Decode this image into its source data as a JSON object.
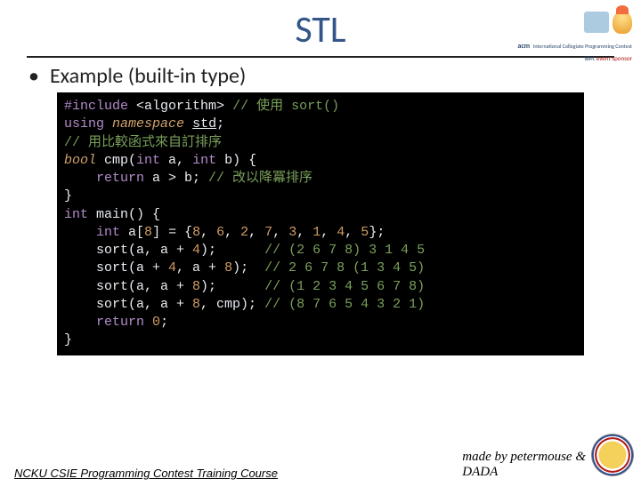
{
  "title": "STL",
  "header_logos": {
    "acm_text": "acm",
    "acm_sub": "International Collegiate Programming Contest",
    "ibm_text": "IBM.",
    "sponsor": "event sponsor"
  },
  "bullet": "Example (built-in type)",
  "code": {
    "l1a": "#include",
    "l1b": "<algorithm>",
    "l1c": "// 使用 sort()",
    "l2a": "using",
    "l2b": "namespace",
    "l2c": "std",
    "l2d": ";",
    "l3": "// 用比較函式來自訂排序",
    "l4a": "bool",
    "l4b": " cmp(",
    "l4c": "int",
    "l4d": " a, ",
    "l4e": "int",
    "l4f": " b) {",
    "l5a": "return",
    "l5b": " a > b; ",
    "l5c": "// 改以降冪排序",
    "l6": "}",
    "l7a": "int",
    "l7b": " main() {",
    "l8a": "int",
    "l8b": " a[",
    "l8c": "8",
    "l8d": "] = {",
    "l8e": "8",
    "l8f": ", ",
    "l8g": "6",
    "l8h": ", ",
    "l8i": "2",
    "l8j": ", ",
    "l8k": "7",
    "l8l": ", ",
    "l8m": "3",
    "l8n": ", ",
    "l8o": "1",
    "l8p": ", ",
    "l8q": "4",
    "l8r": ", ",
    "l8s": "5",
    "l8t": "};",
    "l9a": "    sort(a, a + ",
    "l9b": "4",
    "l9c": ");      ",
    "l9d": "// (2 6 7 8) 3 1 4 5",
    "l10a": "    sort(a + ",
    "l10b": "4",
    "l10c": ", a + ",
    "l10d": "8",
    "l10e": ");  ",
    "l10f": "// 2 6 7 8 (1 3 4 5)",
    "l11a": "    sort(a, a + ",
    "l11b": "8",
    "l11c": ");      ",
    "l11d": "// (1 2 3 4 5 6 7 8)",
    "l12a": "    sort(a, a + ",
    "l12b": "8",
    "l12c": ", cmp); ",
    "l12d": "// (8 7 6 5 4 3 2 1)",
    "l13a": "return",
    "l13b": " ",
    "l13c": "0",
    "l13d": ";",
    "l14": "}"
  },
  "footer": {
    "left": " NCKU CSIE Programming Contest Training Course  ",
    "right_line1": "made by petermouse &",
    "right_line2": "DADA"
  }
}
